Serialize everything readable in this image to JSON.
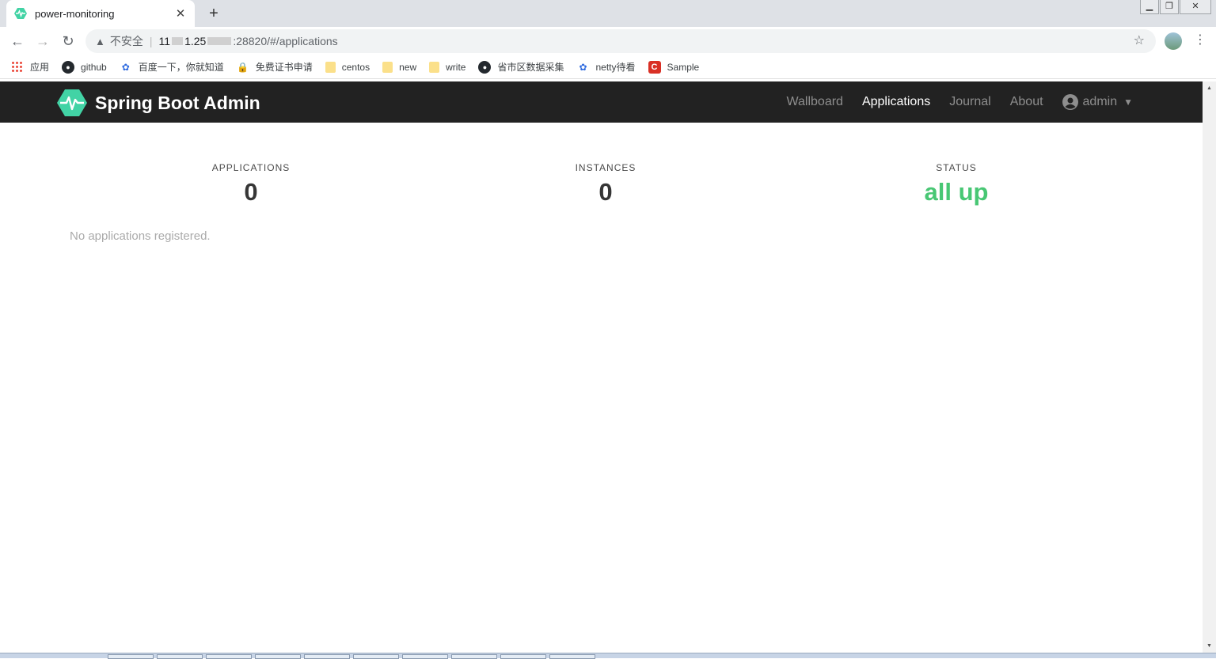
{
  "browser": {
    "tab": {
      "title": "power-monitoring",
      "favicon": "spring-boot-admin-favicon"
    },
    "new_tab_symbol": "+",
    "address": {
      "insecure_label": "不安全",
      "url_prefix": "11",
      "url_host_partial": "1.25",
      "url_suffix": ":28820/#/applications"
    },
    "bookmarks": [
      {
        "label": "应用",
        "icon": "apps-grid-icon"
      },
      {
        "label": "github",
        "icon": "github-icon"
      },
      {
        "label": "百度一下，你就知道",
        "icon": "baidu-paw-icon"
      },
      {
        "label": "免费证书申请",
        "icon": "lock-icon"
      },
      {
        "label": "centos",
        "icon": "folder-icon"
      },
      {
        "label": "new",
        "icon": "folder-icon"
      },
      {
        "label": "write",
        "icon": "folder-icon"
      },
      {
        "label": "省市区数据采集",
        "icon": "github-icon"
      },
      {
        "label": "netty待看",
        "icon": "baidu-paw-icon"
      },
      {
        "label": "Sample",
        "icon": "sample-c-icon"
      }
    ]
  },
  "app": {
    "brand": "Spring Boot Admin",
    "brand_color": "#42d3a5",
    "nav": {
      "wallboard": "Wallboard",
      "applications": "Applications",
      "journal": "Journal",
      "about": "About",
      "user": "admin"
    },
    "stats": {
      "applications_label": "APPLICATIONS",
      "applications_value": "0",
      "instances_label": "INSTANCES",
      "instances_value": "0",
      "status_label": "STATUS",
      "status_value": "all up",
      "status_color": "#48c774"
    },
    "empty_message": "No applications registered."
  }
}
